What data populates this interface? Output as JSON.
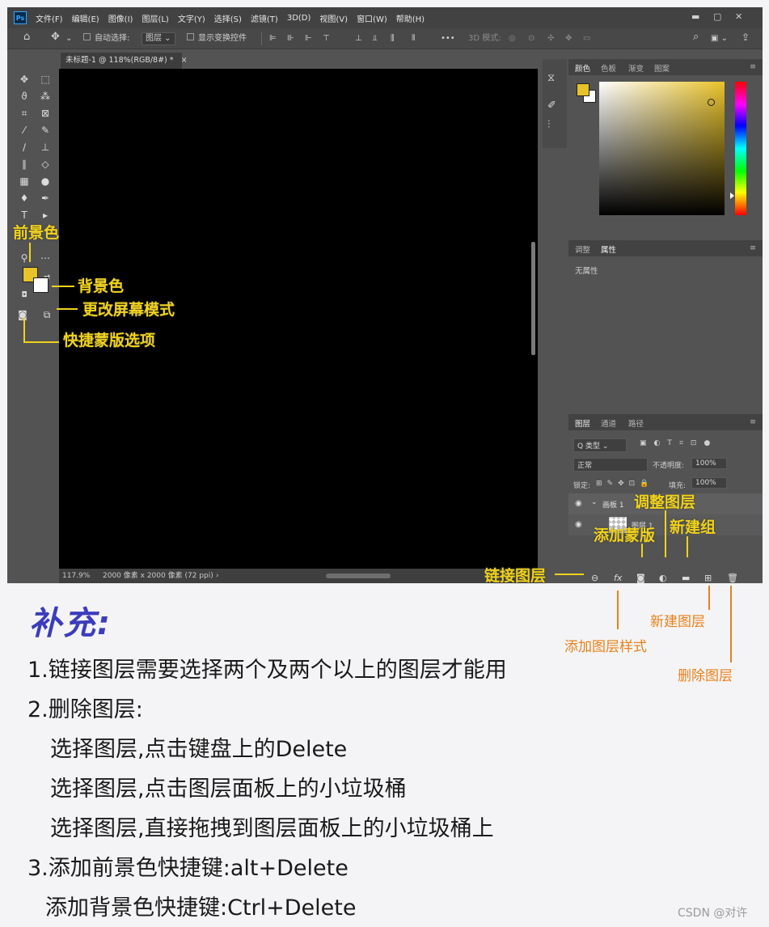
{
  "menubar": {
    "logo": "Ps",
    "items": [
      "文件(F)",
      "编辑(E)",
      "图像(I)",
      "图层(L)",
      "文字(Y)",
      "选择(S)",
      "滤镜(T)",
      "3D(D)",
      "视图(V)",
      "窗口(W)",
      "帮助(H)"
    ]
  },
  "optionsbar": {
    "auto_select": "自动选择:",
    "auto_select_value": "图层",
    "show_transform": "显示变换控件",
    "mode_3d": "3D 模式:"
  },
  "document": {
    "tab_title": "未标题-1 @ 118%(RGB/8#) *",
    "tab_close": "×",
    "status_zoom": "117.9%",
    "status_size": "2000 像素 x 2000 像素 (72 ppi)",
    "status_arrow": "›"
  },
  "color_panel": {
    "tabs": [
      "颜色",
      "色板",
      "渐变",
      "图案"
    ],
    "foreground": "#e8c22a",
    "background": "#ffffff"
  },
  "props_panel": {
    "tabs": [
      "调整",
      "属性"
    ],
    "empty": "无属性"
  },
  "layers_panel": {
    "tabs": [
      "图层",
      "通道",
      "路径"
    ],
    "filter": "Q 类型",
    "blend_mode": "正常",
    "opacity_label": "不透明度:",
    "opacity_value": "100%",
    "lock_label": "锁定:",
    "fill_label": "填充:",
    "fill_value": "100%",
    "layers": [
      "画板 1",
      "图层 1"
    ]
  },
  "annotations": {
    "foreground_color": "前景色",
    "background_color": "背景色",
    "change_screen_mode": "更改屏幕模式",
    "quick_mask": "快捷蒙版选项",
    "adjust_layer": "调整图层",
    "add_mask": "添加蒙版",
    "new_group": "新建组",
    "link_layers": "链接图层",
    "new_layer": "新建图层",
    "add_layer_style": "添加图层样式",
    "delete_layer": "删除图层"
  },
  "notes": {
    "title": "补充:",
    "lines": [
      "1.链接图层需要选择两个及两个以上的图层才能用",
      "2.删除图层:",
      "选择图层,点击键盘上的Delete",
      "选择图层,点击图层面板上的小垃圾桶",
      "选择图层,直接拖拽到图层面板上的小垃圾桶上",
      "3.添加前景色快捷键:alt+Delete",
      "添加背景色快捷键:Ctrl+Delete"
    ]
  },
  "watermark": "CSDN @对许"
}
